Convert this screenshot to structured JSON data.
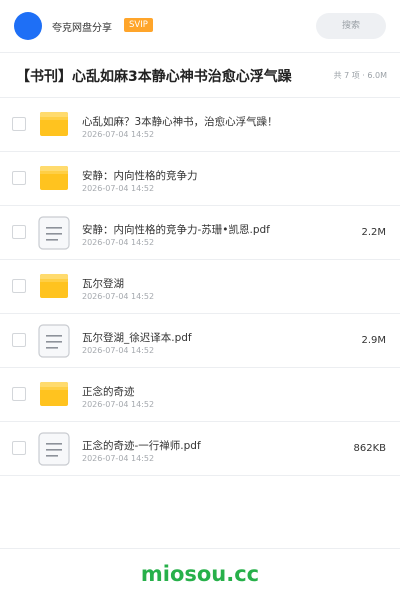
{
  "header": {
    "app_name": "夸克网盘分享",
    "badge": "SVIP",
    "search_label": "搜索",
    "avatar_color": "#1e6ff6",
    "badge_color": "#ffa52a"
  },
  "share": {
    "title": "【书刊】心乱如麻3本静心神书治愈心浮气躁",
    "meta": "共 7 项 · 6.0M"
  },
  "files": [
    {
      "type": "folder",
      "icon": "folder-icon",
      "name": "心乱如麻？3本静心神书，治愈心浮气躁！",
      "date": "2026-07-04 14:52",
      "size": ""
    },
    {
      "type": "folder",
      "icon": "folder-icon",
      "name": "安静：内向性格的竞争力",
      "date": "2026-07-04 14:52",
      "size": ""
    },
    {
      "type": "pdf",
      "icon": "document-icon",
      "name": "安静：内向性格的竞争力-苏珊•凯恩.pdf",
      "date": "2026-07-04 14:52",
      "size": "2.2M"
    },
    {
      "type": "folder",
      "icon": "folder-icon",
      "name": "瓦尔登湖",
      "date": "2026-07-04 14:52",
      "size": ""
    },
    {
      "type": "pdf",
      "icon": "document-icon",
      "name": "瓦尔登湖_徐迟译本.pdf",
      "date": "2026-07-04 14:52",
      "size": "2.9M"
    },
    {
      "type": "folder",
      "icon": "folder-icon",
      "name": "正念的奇迹",
      "date": "2026-07-04 14:52",
      "size": ""
    },
    {
      "type": "pdf",
      "icon": "document-icon",
      "name": "正念的奇迹-一行禅师.pdf",
      "date": "2026-07-04 14:52",
      "size": "862KB"
    }
  ],
  "footer": {
    "brand": "miosou.cc",
    "brand_color": "#27b04a"
  }
}
